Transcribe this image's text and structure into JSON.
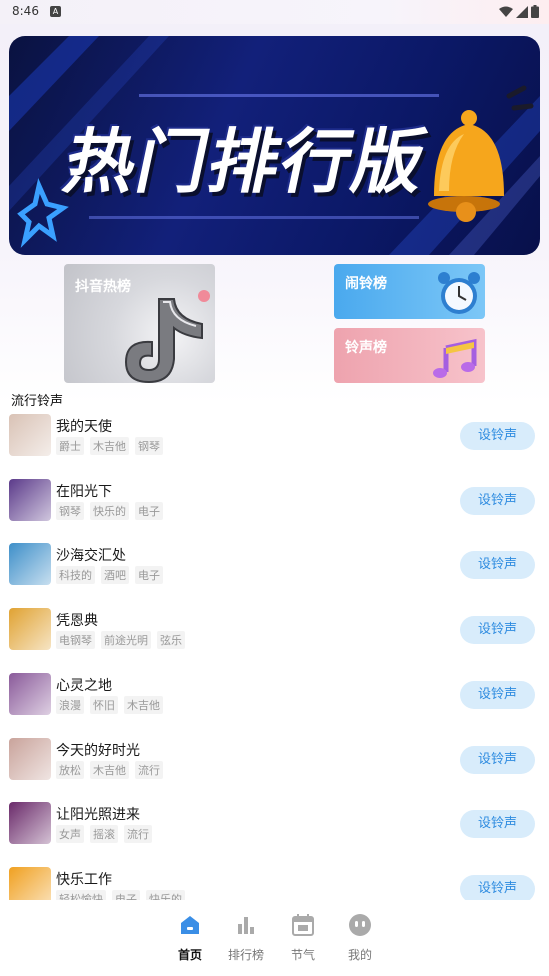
{
  "status_bar": {
    "time": "8:46",
    "notification_icon": "A"
  },
  "banner": {
    "title": "热门排行版",
    "dots": 3,
    "active_dot": 0
  },
  "categories": {
    "douyin": "抖音热榜",
    "alarm": "闹铃榜",
    "ringtone": "铃声榜"
  },
  "section": {
    "title": "流行铃声"
  },
  "button_label": "设铃声",
  "songs": [
    {
      "name": "我的天使",
      "tags": [
        "爵士",
        "木吉他",
        "钢琴"
      ],
      "cover": "#d9c2b5"
    },
    {
      "name": "在阳光下",
      "tags": [
        "钢琴",
        "快乐的",
        "电子"
      ],
      "cover": "#5b3a8a"
    },
    {
      "name": "沙海交汇处",
      "tags": [
        "科技的",
        "酒吧",
        "电子"
      ],
      "cover": "#3e8fc9"
    },
    {
      "name": "凭恩典",
      "tags": [
        "电钢琴",
        "前途光明",
        "弦乐"
      ],
      "cover": "#e0a232"
    },
    {
      "name": "心灵之地",
      "tags": [
        "浪漫",
        "怀旧",
        "木吉他"
      ],
      "cover": "#8a5a9a"
    },
    {
      "name": "今天的好时光",
      "tags": [
        "放松",
        "木吉他",
        "流行"
      ],
      "cover": "#c9a39b"
    },
    {
      "name": "让阳光照进来",
      "tags": [
        "女声",
        "摇滚",
        "流行"
      ],
      "cover": "#6a2a6a"
    },
    {
      "name": "快乐工作",
      "tags": [
        "轻松愉快",
        "电子",
        "快乐的"
      ],
      "cover": "#f0a020"
    }
  ],
  "bottom_nav": [
    {
      "label": "首页",
      "icon": "home-icon",
      "active": true
    },
    {
      "label": "排行榜",
      "icon": "bar-chart-icon",
      "active": false
    },
    {
      "label": "节气",
      "icon": "calendar-icon",
      "active": false
    },
    {
      "label": "我的",
      "icon": "profile-icon",
      "active": false
    }
  ],
  "colors": {
    "accent": "#2f8ce0",
    "button_bg": "#d8ecfb",
    "nav_active": "#3a8ee6"
  }
}
